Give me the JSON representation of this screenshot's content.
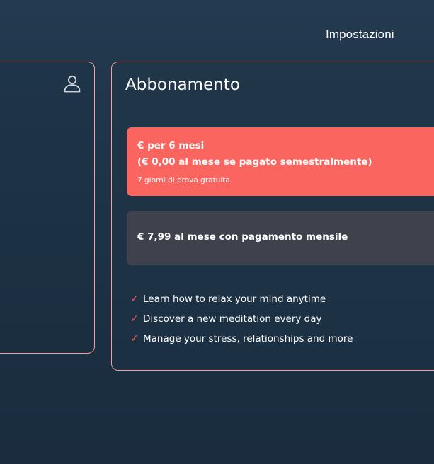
{
  "header": {
    "settings_label": "Impostazioni"
  },
  "left_panel": {
    "icon": "user-icon"
  },
  "subscription": {
    "title": "Abbonamento",
    "semiannual": {
      "line1": "€  per 6 mesi",
      "line2": "(€ 0,00 al mese se pagato semestralmente)",
      "trial": "7 giorni di prova gratuita",
      "color": "#fb6560"
    },
    "monthly": {
      "label": "€ 7,99 al mese con pagamento mensile",
      "color": "#3f414c"
    },
    "features": [
      "Learn how to relax your mind anytime",
      "Discover a new meditation every day",
      "Manage your stress, relationships and more"
    ],
    "check_icon": "✓",
    "check_color": "#fb5a55",
    "border_color": "#f2a09a"
  }
}
